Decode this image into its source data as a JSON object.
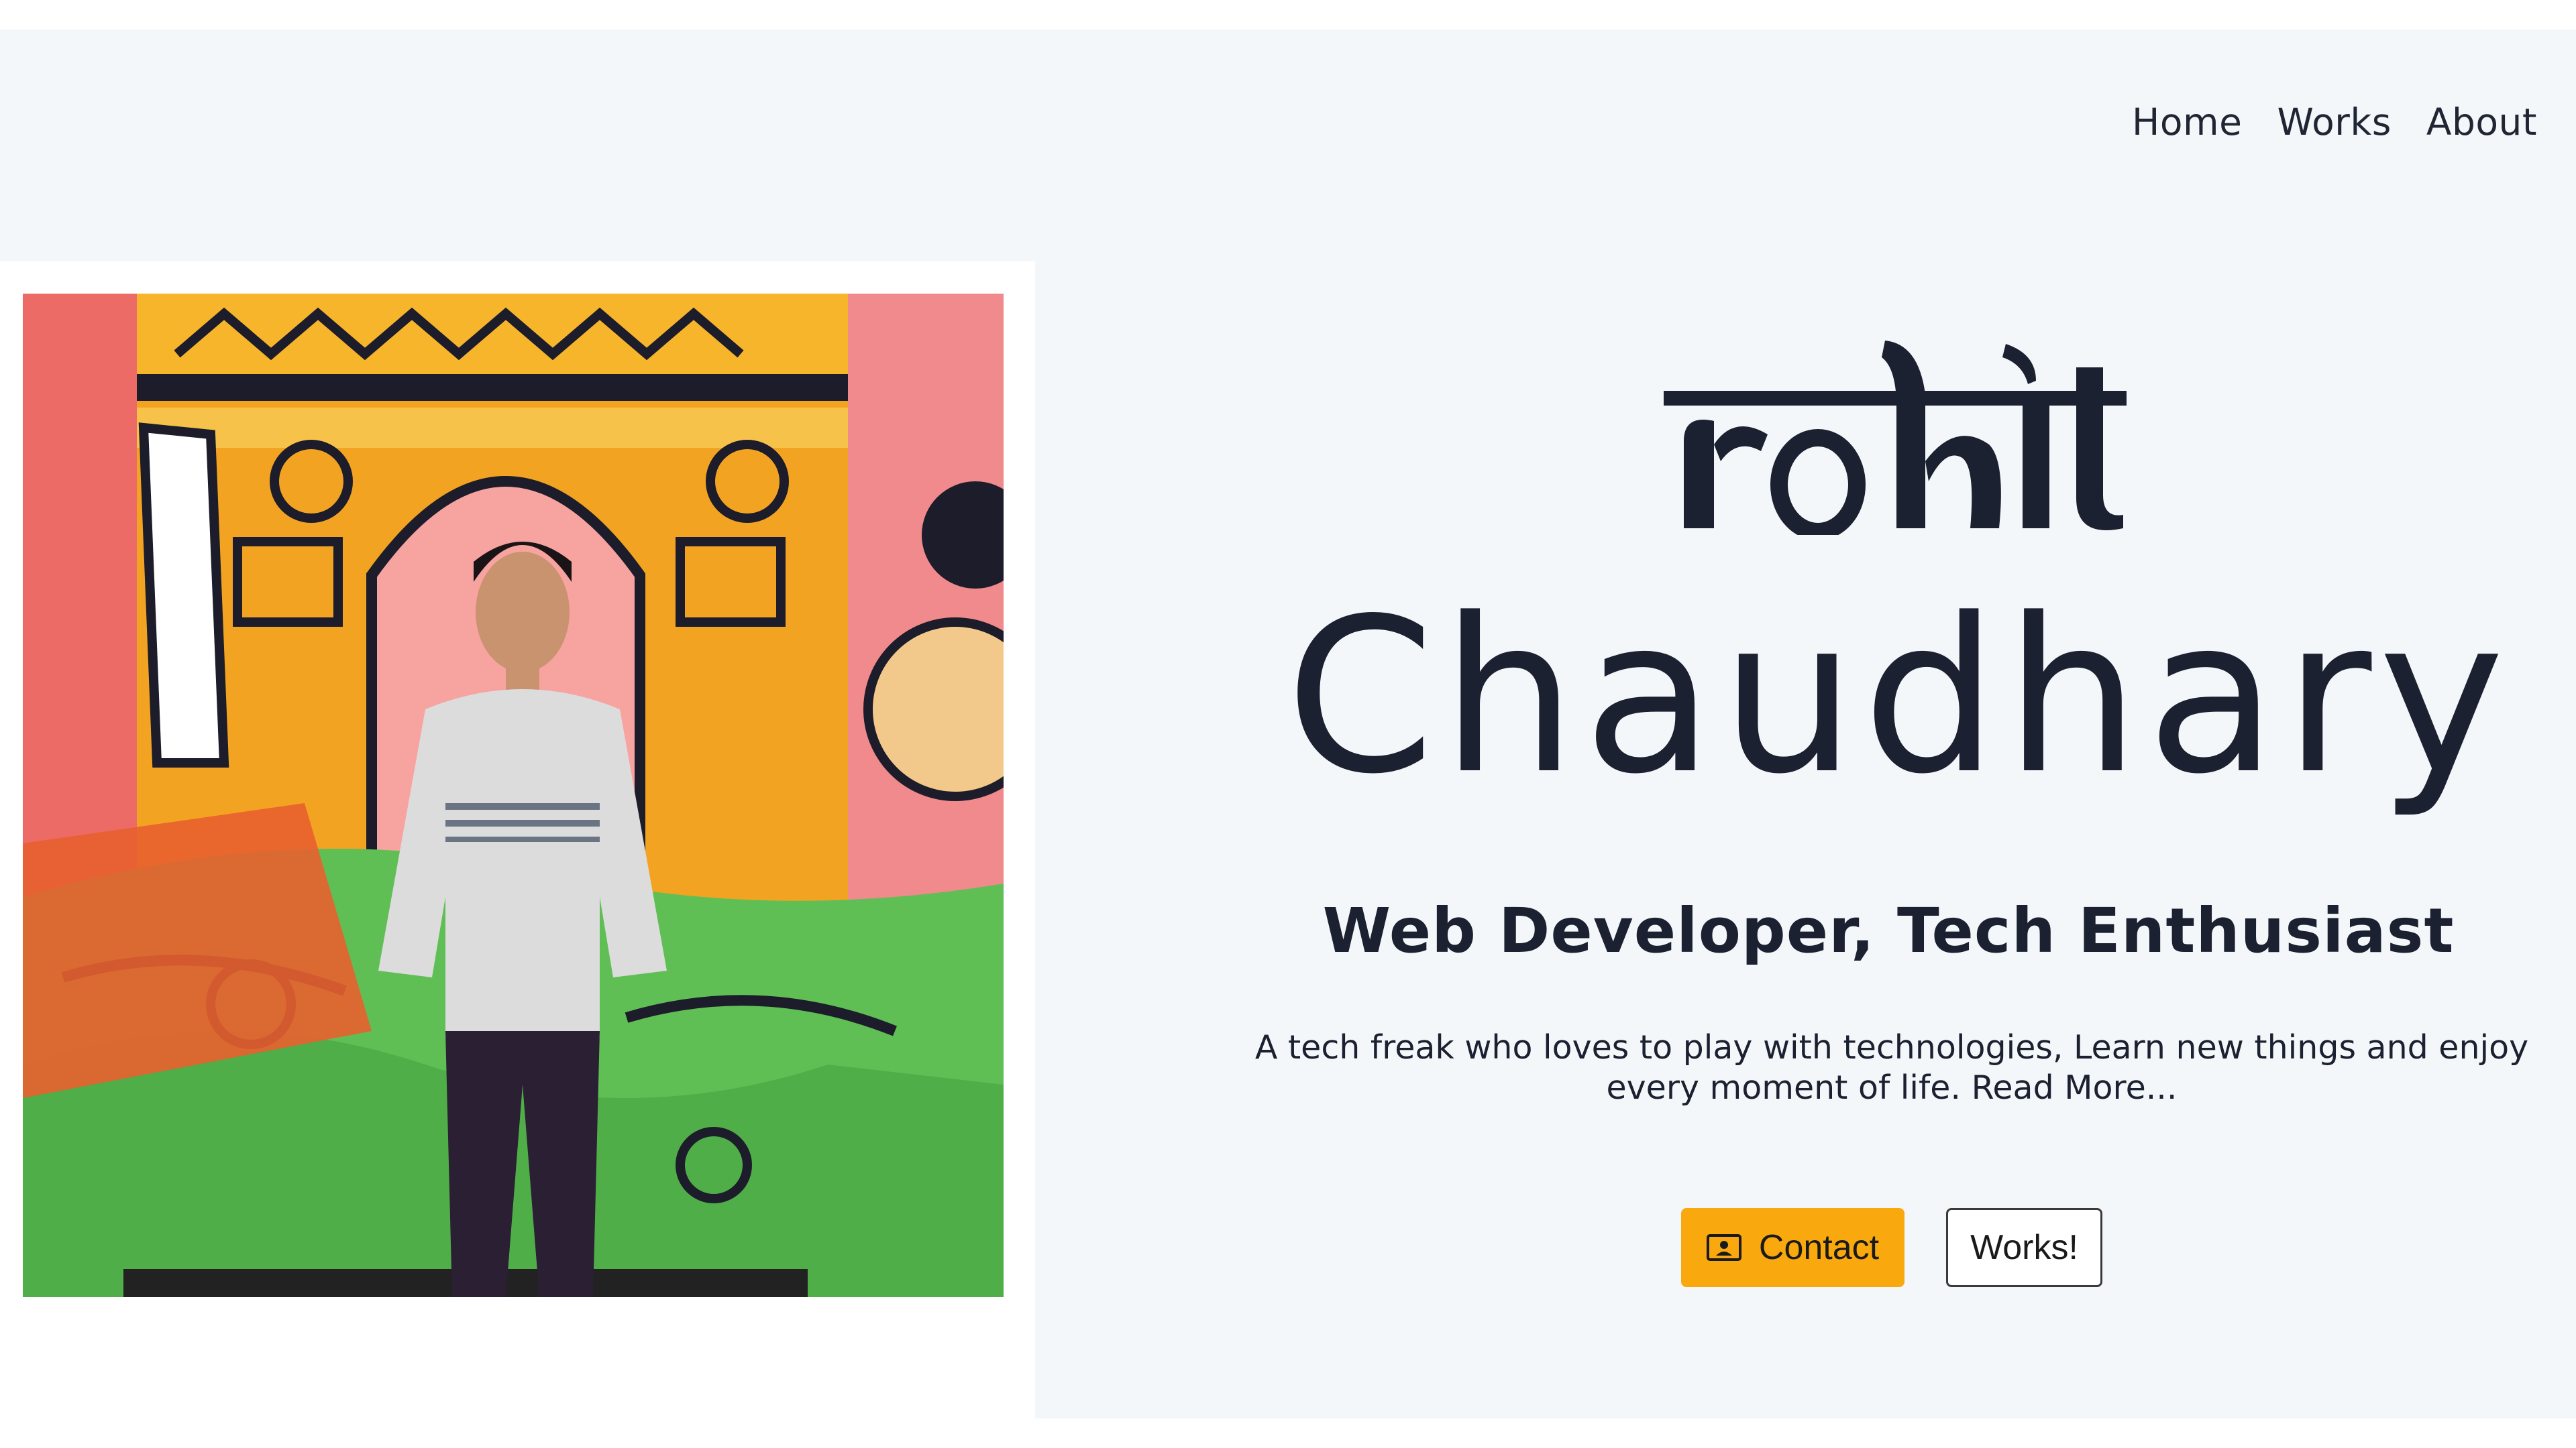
{
  "nav": {
    "items": [
      {
        "label": "Home"
      },
      {
        "label": "Works"
      },
      {
        "label": "About"
      }
    ]
  },
  "hero": {
    "logo_text": "rohit",
    "surname": "Chaudhary",
    "subtitle": "Web Developer, Tech Enthusiast",
    "bio_text": "A tech freak who loves to play with technologies, Learn new things and enjoy every moment of life.",
    "read_more": "Read More..."
  },
  "buttons": {
    "contact_label": "Contact",
    "contact_icon": "contact-card-icon",
    "works_label": "Works!"
  },
  "photo": {
    "description_icon": "profile-photo"
  },
  "colors": {
    "accent": "#f9a80e",
    "text": "#1b2130",
    "panel_bg": "#f4f7fa"
  }
}
